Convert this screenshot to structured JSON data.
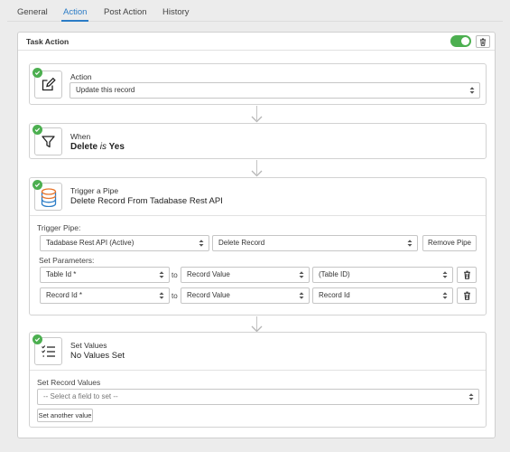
{
  "tabs": [
    {
      "label": "General",
      "active": false
    },
    {
      "label": "Action",
      "active": true
    },
    {
      "label": "Post Action",
      "active": false
    },
    {
      "label": "History",
      "active": false
    }
  ],
  "task": {
    "title": "Task Action",
    "enabled": true
  },
  "action_card": {
    "label": "Action",
    "select_value": "Update this record"
  },
  "when_card": {
    "label": "When",
    "condition_field": "Delete",
    "condition_operator": "is",
    "condition_value": "Yes"
  },
  "trigger_card": {
    "label": "Trigger a Pipe",
    "value": "Delete Record From Tadabase Rest API",
    "trigger_pipe_label": "Trigger Pipe:",
    "pipe_select": "Tadabase Rest API (Active)",
    "operation_select": "Delete Record",
    "remove_pipe_label": "Remove Pipe",
    "set_parameters_label": "Set Parameters:",
    "to_label": "to",
    "parameters": [
      {
        "param": "Table Id *",
        "type": "Record Value",
        "value": "(Table ID)"
      },
      {
        "param": "Record Id *",
        "type": "Record Value",
        "value": "Record Id"
      }
    ]
  },
  "set_values_card": {
    "label": "Set Values",
    "value": "No Values Set",
    "set_record_values_label": "Set Record Values",
    "field_placeholder": "-- Select a field to set --",
    "set_another_label": "Set another value"
  },
  "colors": {
    "accent": "#2b7cc6",
    "success": "#4caf50",
    "border": "#d2d2d2"
  }
}
